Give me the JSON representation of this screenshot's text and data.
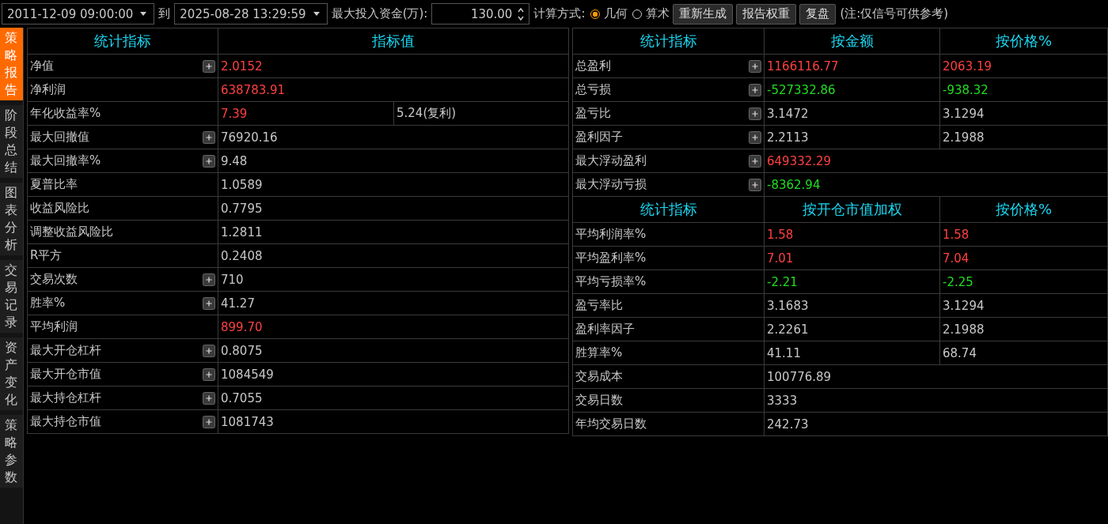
{
  "toolbar": {
    "start_time": "2011-12-09 09:00:00",
    "to_label": "到",
    "end_time": "2025-08-28 13:29:59",
    "capital": {
      "label": "最大投入资金(万):",
      "value": "130.00"
    },
    "calc_mode": {
      "label": "计算方式:",
      "options": [
        {
          "label": "几何",
          "selected": true
        },
        {
          "label": "算术",
          "selected": false
        }
      ]
    },
    "buttons": [
      "重新生成",
      "报告权重",
      "复盘"
    ],
    "note": "(注:仅信号可供参考)"
  },
  "side_tabs": [
    {
      "label": "策略报告",
      "selected": true
    },
    {
      "label": "阶段总结",
      "selected": false
    },
    {
      "label": "图表分析",
      "selected": false
    },
    {
      "label": "交易记录",
      "selected": false
    },
    {
      "label": "资产变化",
      "selected": false
    },
    {
      "label": "策略参数",
      "selected": false
    }
  ],
  "left_table": {
    "columns": [
      "统计指标",
      "指标值"
    ],
    "rows": [
      {
        "label": "净值",
        "expandable": true,
        "values": [
          {
            "text": "2.0152",
            "color": "#ff4040"
          }
        ]
      },
      {
        "label": "净利润",
        "expandable": false,
        "values": [
          {
            "text": "638783.91",
            "color": "#ff4040"
          }
        ]
      },
      {
        "label": "年化收益率%",
        "expandable": false,
        "values": [
          {
            "text": "7.39",
            "color": "#ff4040"
          },
          {
            "text": "5.24(复利)",
            "color": "#c8c8c8"
          }
        ]
      },
      {
        "label": "最大回撤值",
        "expandable": true,
        "values": [
          {
            "text": "76920.16",
            "color": "#c8c8c8"
          }
        ]
      },
      {
        "label": "最大回撤率%",
        "expandable": true,
        "values": [
          {
            "text": "9.48",
            "color": "#c8c8c8"
          }
        ]
      },
      {
        "label": "夏普比率",
        "expandable": false,
        "values": [
          {
            "text": "1.0589",
            "color": "#c8c8c8"
          }
        ]
      },
      {
        "label": "收益风险比",
        "expandable": false,
        "values": [
          {
            "text": "0.7795",
            "color": "#c8c8c8"
          }
        ]
      },
      {
        "label": "调整收益风险比",
        "expandable": false,
        "values": [
          {
            "text": "1.2811",
            "color": "#c8c8c8"
          }
        ]
      },
      {
        "label": "R平方",
        "expandable": false,
        "values": [
          {
            "text": "0.2408",
            "color": "#c8c8c8"
          }
        ]
      },
      {
        "label": "交易次数",
        "expandable": true,
        "values": [
          {
            "text": "710",
            "color": "#c8c8c8"
          }
        ]
      },
      {
        "label": "胜率%",
        "expandable": true,
        "values": [
          {
            "text": "41.27",
            "color": "#c8c8c8"
          }
        ]
      },
      {
        "label": "平均利润",
        "expandable": false,
        "values": [
          {
            "text": "899.70",
            "color": "#ff4040"
          }
        ]
      },
      {
        "label": "最大开仓杠杆",
        "expandable": true,
        "values": [
          {
            "text": "0.8075",
            "color": "#c8c8c8"
          }
        ]
      },
      {
        "label": "最大开仓市值",
        "expandable": true,
        "values": [
          {
            "text": "1084549",
            "color": "#c8c8c8"
          }
        ]
      },
      {
        "label": "最大持仓杠杆",
        "expandable": true,
        "values": [
          {
            "text": "0.7055",
            "color": "#c8c8c8"
          }
        ]
      },
      {
        "label": "最大持仓市值",
        "expandable": true,
        "values": [
          {
            "text": "1081743",
            "color": "#c8c8c8"
          }
        ]
      }
    ]
  },
  "right_table": {
    "sections": [
      {
        "columns": [
          "统计指标",
          "按金额",
          "按价格%"
        ],
        "rows": [
          {
            "label": "总盈利",
            "expandable": true,
            "values": [
              {
                "text": "1166116.77",
                "color": "#ff4040"
              },
              {
                "text": "2063.19",
                "color": "#ff4040"
              }
            ]
          },
          {
            "label": "总亏损",
            "expandable": true,
            "values": [
              {
                "text": "-527332.86",
                "color": "#22dd22"
              },
              {
                "text": "-938.32",
                "color": "#22dd22"
              }
            ]
          },
          {
            "label": "盈亏比",
            "expandable": true,
            "values": [
              {
                "text": "3.1472",
                "color": "#c8c8c8"
              },
              {
                "text": "3.1294",
                "color": "#c8c8c8"
              }
            ]
          },
          {
            "label": "盈利因子",
            "expandable": true,
            "values": [
              {
                "text": "2.2113",
                "color": "#c8c8c8"
              },
              {
                "text": "2.1988",
                "color": "#c8c8c8"
              }
            ]
          },
          {
            "label": "最大浮动盈利",
            "expandable": true,
            "values": [
              {
                "text": "649332.29",
                "color": "#ff4040"
              }
            ]
          },
          {
            "label": "最大浮动亏损",
            "expandable": true,
            "values": [
              {
                "text": "-8362.94",
                "color": "#22dd22"
              }
            ]
          }
        ]
      },
      {
        "columns": [
          "统计指标",
          "按开仓市值加权",
          "按价格%"
        ],
        "rows": [
          {
            "label": "平均利润率%",
            "expandable": false,
            "values": [
              {
                "text": "1.58",
                "color": "#ff4040"
              },
              {
                "text": "1.58",
                "color": "#ff4040"
              }
            ]
          },
          {
            "label": "平均盈利率%",
            "expandable": false,
            "values": [
              {
                "text": "7.01",
                "color": "#ff4040"
              },
              {
                "text": "7.04",
                "color": "#ff4040"
              }
            ]
          },
          {
            "label": "平均亏损率%",
            "expandable": false,
            "values": [
              {
                "text": "-2.21",
                "color": "#22dd22"
              },
              {
                "text": "-2.25",
                "color": "#22dd22"
              }
            ]
          },
          {
            "label": "盈亏率比",
            "expandable": false,
            "values": [
              {
                "text": "3.1683",
                "color": "#c8c8c8"
              },
              {
                "text": "3.1294",
                "color": "#c8c8c8"
              }
            ]
          },
          {
            "label": "盈利率因子",
            "expandable": false,
            "values": [
              {
                "text": "2.2261",
                "color": "#c8c8c8"
              },
              {
                "text": "2.1988",
                "color": "#c8c8c8"
              }
            ]
          },
          {
            "label": "胜算率%",
            "expandable": false,
            "values": [
              {
                "text": "41.11",
                "color": "#c8c8c8"
              },
              {
                "text": "68.74",
                "color": "#c8c8c8"
              }
            ]
          },
          {
            "label": "交易成本",
            "expandable": false,
            "values": [
              {
                "text": "100776.89",
                "color": "#c8c8c8"
              }
            ]
          },
          {
            "label": "交易日数",
            "expandable": false,
            "values": [
              {
                "text": "3333",
                "color": "#c8c8c8"
              }
            ]
          },
          {
            "label": "年均交易日数",
            "expandable": false,
            "values": [
              {
                "text": "242.73",
                "color": "#c8c8c8"
              }
            ]
          }
        ]
      }
    ]
  }
}
